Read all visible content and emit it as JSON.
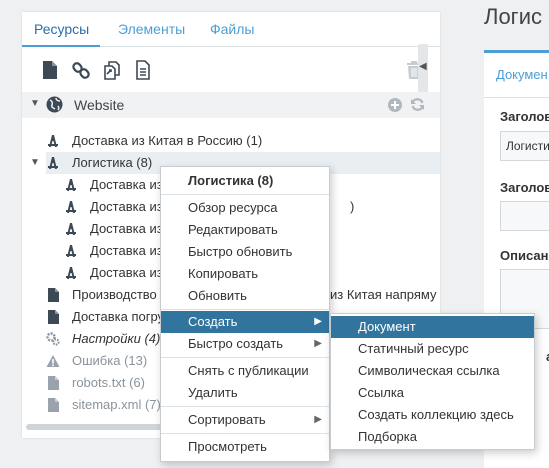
{
  "tabs": [
    {
      "label": "Ресурсы",
      "active": true
    },
    {
      "label": "Элементы",
      "active": false
    },
    {
      "label": "Файлы",
      "active": false
    }
  ],
  "toolbar": {
    "icons": [
      "new-document-icon",
      "new-weblink-icon",
      "new-symlink-icon",
      "new-static-resource-icon",
      "trash-icon"
    ]
  },
  "tree": {
    "root": {
      "label": "Website",
      "icon": "globe-icon"
    },
    "nodes": [
      {
        "label": "Доставка из Китая в Россию (1)",
        "icon": "folder-resource-icon",
        "level": 1
      },
      {
        "label": "Логистика (8)",
        "icon": "folder-resource-icon",
        "level": 1,
        "expanded": true,
        "selected": true
      },
      {
        "label": "Доставка из",
        "suffix": "",
        "icon": "folder-resource-icon",
        "level": 2
      },
      {
        "label": "Доставка из",
        "suffix": ")",
        "icon": "folder-resource-icon",
        "level": 2
      },
      {
        "label": "Доставка из",
        "suffix": "",
        "icon": "folder-resource-icon",
        "level": 2
      },
      {
        "label": "Доставка из",
        "suffix": "",
        "icon": "folder-resource-icon",
        "level": 2
      },
      {
        "label": "Доставка из",
        "suffix": "",
        "icon": "folder-resource-icon",
        "level": 2
      },
      {
        "label": "Производство",
        "suffix": "из Китая напряму",
        "icon": "document-icon",
        "level": 1
      },
      {
        "label": "Доставка погру",
        "suffix": "",
        "icon": "document-icon",
        "level": 1
      },
      {
        "label": "Настройки (4)",
        "icon": "gears-icon",
        "level": 1,
        "italic": true
      },
      {
        "label": "Ошибка (13)",
        "icon": "warning-icon",
        "level": 1,
        "muted": true
      },
      {
        "label": "robots.txt (6)",
        "icon": "document-icon",
        "level": 1,
        "muted": true
      },
      {
        "label": "sitemap.xml (7)",
        "icon": "document-icon",
        "level": 1,
        "muted": true
      }
    ]
  },
  "editor": {
    "title": "Логис",
    "tab": "Докумен",
    "field1_label": "Заголов",
    "field1_value": "Логисти",
    "field2_label": "Заголов",
    "field3_label": "Описан",
    "field4_label": "ан"
  },
  "context_menu": {
    "header": "Логистика (8)",
    "items": [
      {
        "label": "Обзор ресурса"
      },
      {
        "label": "Редактировать"
      },
      {
        "label": "Быстро обновить"
      },
      {
        "label": "Копировать"
      },
      {
        "label": "Обновить"
      },
      {
        "label": "Создать",
        "submenu": true,
        "active": true
      },
      {
        "label": "Быстро создать",
        "submenu": true
      },
      {
        "label": "Снять с публикации"
      },
      {
        "label": "Удалить"
      },
      {
        "label": "Сортировать",
        "submenu": true
      },
      {
        "label": "Просмотреть"
      }
    ]
  },
  "submenu": {
    "items": [
      {
        "label": "Документ",
        "active": true
      },
      {
        "label": "Статичный ресурс"
      },
      {
        "label": "Символическая ссылка"
      },
      {
        "label": "Ссылка"
      },
      {
        "label": "Создать коллекцию здесь"
      },
      {
        "label": "Подборка"
      }
    ]
  },
  "colors": {
    "accent": "#4b9fd5",
    "menu_active": "#31759f",
    "icon_dark": "#3d4a56",
    "icon_muted": "#9aa3ab"
  }
}
